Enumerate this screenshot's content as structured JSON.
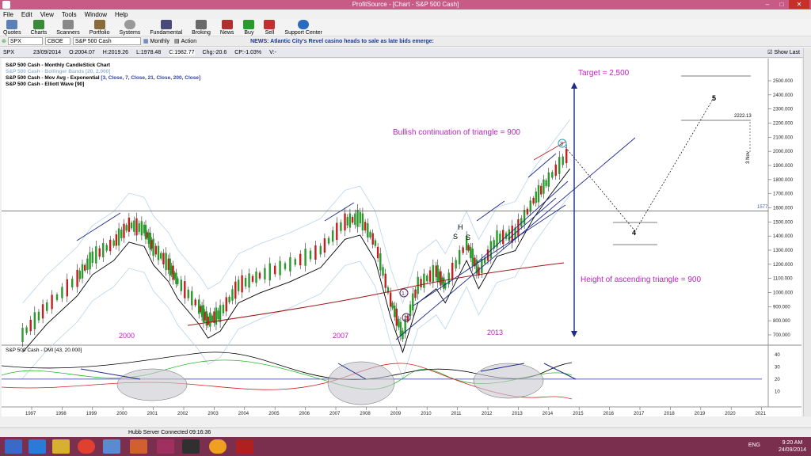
{
  "window": {
    "title": "ProfitSource - [Chart - S&P 500 Cash]"
  },
  "menu": [
    "File",
    "Edit",
    "View",
    "Tools",
    "Window",
    "Help"
  ],
  "toolbar": [
    "Quotes",
    "Charts",
    "Scanners",
    "Portfolio",
    "Systems",
    "Fundamental",
    "Broking",
    "News",
    "Buy",
    "Sell",
    "Support Center"
  ],
  "symbolbar": {
    "symbol": "SPX",
    "exchange": "CBOE",
    "name": "S&P 500 Cash",
    "period": "Monthly",
    "action": "Action",
    "news_label": "NEWS:",
    "news_text": "Atlantic City's Revel casino heads to sale as late bids emerge:"
  },
  "quote": {
    "sym": "SPX",
    "date": "23/09/2014",
    "open": "O:2004.07",
    "high": "H:2019.26",
    "low": "L:1978.48",
    "close": "C:1982.77",
    "chg": "Chg:-20.6",
    "cp": "CP:-1.03%",
    "v": "V:-",
    "show_last": "Show Last"
  },
  "legend": {
    "l1": "S&P 500 Cash - Monthly CandleStick Chart",
    "l2": "S&P 500 Cash - Bollinger Bands [20, 2.000]",
    "l3_prefix": "S&P 500 Cash - Mov Avg - Exponential",
    "l3_params": "[3, Close, 7, Close, 21, Close, 200, Close]",
    "l4": "S&P 500 Cash - Elliott Wave [90]",
    "sub": "S&P 500 Cash - DMI [43, 20.000]"
  },
  "annotations": {
    "target": "Target = 2,500",
    "bullish": "Bullish continuation of triangle = 900",
    "height": "Height of ascending triangle = 900",
    "y2000": "2000",
    "y2007": "2007",
    "y2013": "2013",
    "h": "H",
    "s1": "S",
    "s2": "S",
    "wave1": "1",
    "wave2": "2",
    "wave3": "3",
    "wave4": "4",
    "wave5": "5",
    "price_2222": "2222.13",
    "price_1577": "1577",
    "date_nov": "3 Nov"
  },
  "y_ticks": [
    "2500.000",
    "2400.000",
    "2300.000",
    "2200.000",
    "2100.000",
    "2000.000",
    "1900.000",
    "1800.000",
    "1700.000",
    "1600.000",
    "1500.000",
    "1400.000",
    "1300.000",
    "1200.000",
    "1100.000",
    "1000.000",
    "900.000",
    "800.000",
    "700.000"
  ],
  "sub_ticks": [
    "40",
    "30",
    "20",
    "10"
  ],
  "x_ticks": [
    "1997",
    "1998",
    "1999",
    "2000",
    "2001",
    "2002",
    "2003",
    "2004",
    "2005",
    "2006",
    "2007",
    "2008",
    "2009",
    "2010",
    "2011",
    "2012",
    "2013",
    "2014",
    "2015",
    "2016",
    "2017",
    "2018",
    "2019",
    "2020",
    "2021"
  ],
  "status": {
    "server": "Hubb Server Connected 09:16:36"
  },
  "clock": {
    "time": "9:20 AM",
    "date": "24/09/2014",
    "lang": "ENG"
  },
  "colors": {
    "titlebar": "#c85a86",
    "magenta_text": "#c020c0",
    "navy": "#1c2a8c",
    "ema200": "#a01818"
  }
}
